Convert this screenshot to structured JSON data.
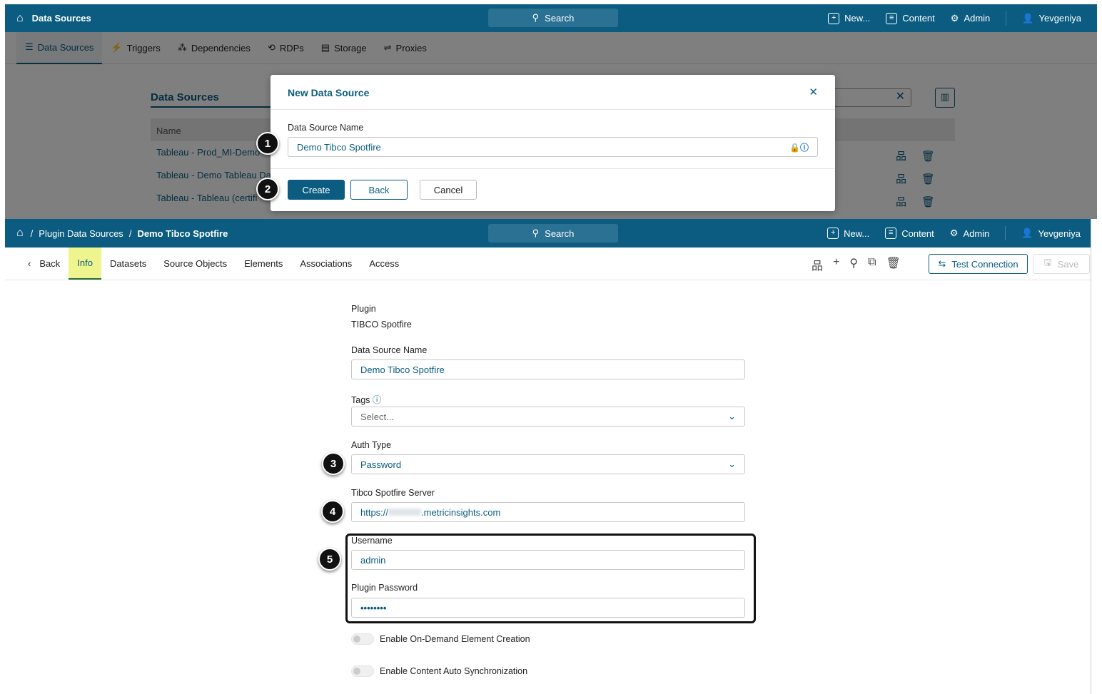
{
  "top": {
    "header": {
      "title": "Data Sources",
      "search": "Search",
      "new": "New...",
      "content": "Content",
      "admin": "Admin",
      "user": "Yevgeniya"
    },
    "subnav": [
      "Data Sources",
      "Triggers",
      "Dependencies",
      "RDPs",
      "Storage",
      "Proxies"
    ],
    "page_title": "Data Sources",
    "table": {
      "header": "Name",
      "rows": [
        "Tableau - Prod_MI-Demo",
        "Tableau - Demo Tableau Da",
        "Tableau - Tableau (certifi"
      ]
    },
    "modal": {
      "title": "New Data Source",
      "field_label": "Data Source Name",
      "field_value": "Demo Tibco Spotfire",
      "create": "Create",
      "back": "Back",
      "cancel": "Cancel"
    }
  },
  "bottom": {
    "header": {
      "breadcrumb_1": "Plugin Data Sources",
      "breadcrumb_2": "Demo Tibco Spotfire",
      "search": "Search",
      "new": "New...",
      "content": "Content",
      "admin": "Admin",
      "user": "Yevgeniya"
    },
    "tabs": {
      "back": "Back",
      "items": [
        "Info",
        "Datasets",
        "Source Objects",
        "Elements",
        "Associations",
        "Access"
      ]
    },
    "actions": {
      "test_connection": "Test Connection",
      "save": "Save"
    },
    "form": {
      "plugin_label": "Plugin",
      "plugin_value": "TIBCO Spotfire",
      "name_label": "Data Source Name",
      "name_value": "Demo Tibco Spotfire",
      "tags_label": "Tags",
      "tags_placeholder": "Select...",
      "auth_label": "Auth Type",
      "auth_value": "Password",
      "server_label": "Tibco Spotfire Server",
      "server_prefix": "https://",
      "server_suffix": ".metricinsights.com",
      "username_label": "Username",
      "username_value": "admin",
      "password_label": "Plugin Password",
      "password_value": "••••••••",
      "toggle1": "Enable On-Demand Element Creation",
      "toggle2": "Enable Content Auto Synchronization"
    }
  },
  "callouts": [
    "1",
    "2",
    "3",
    "4",
    "5"
  ]
}
